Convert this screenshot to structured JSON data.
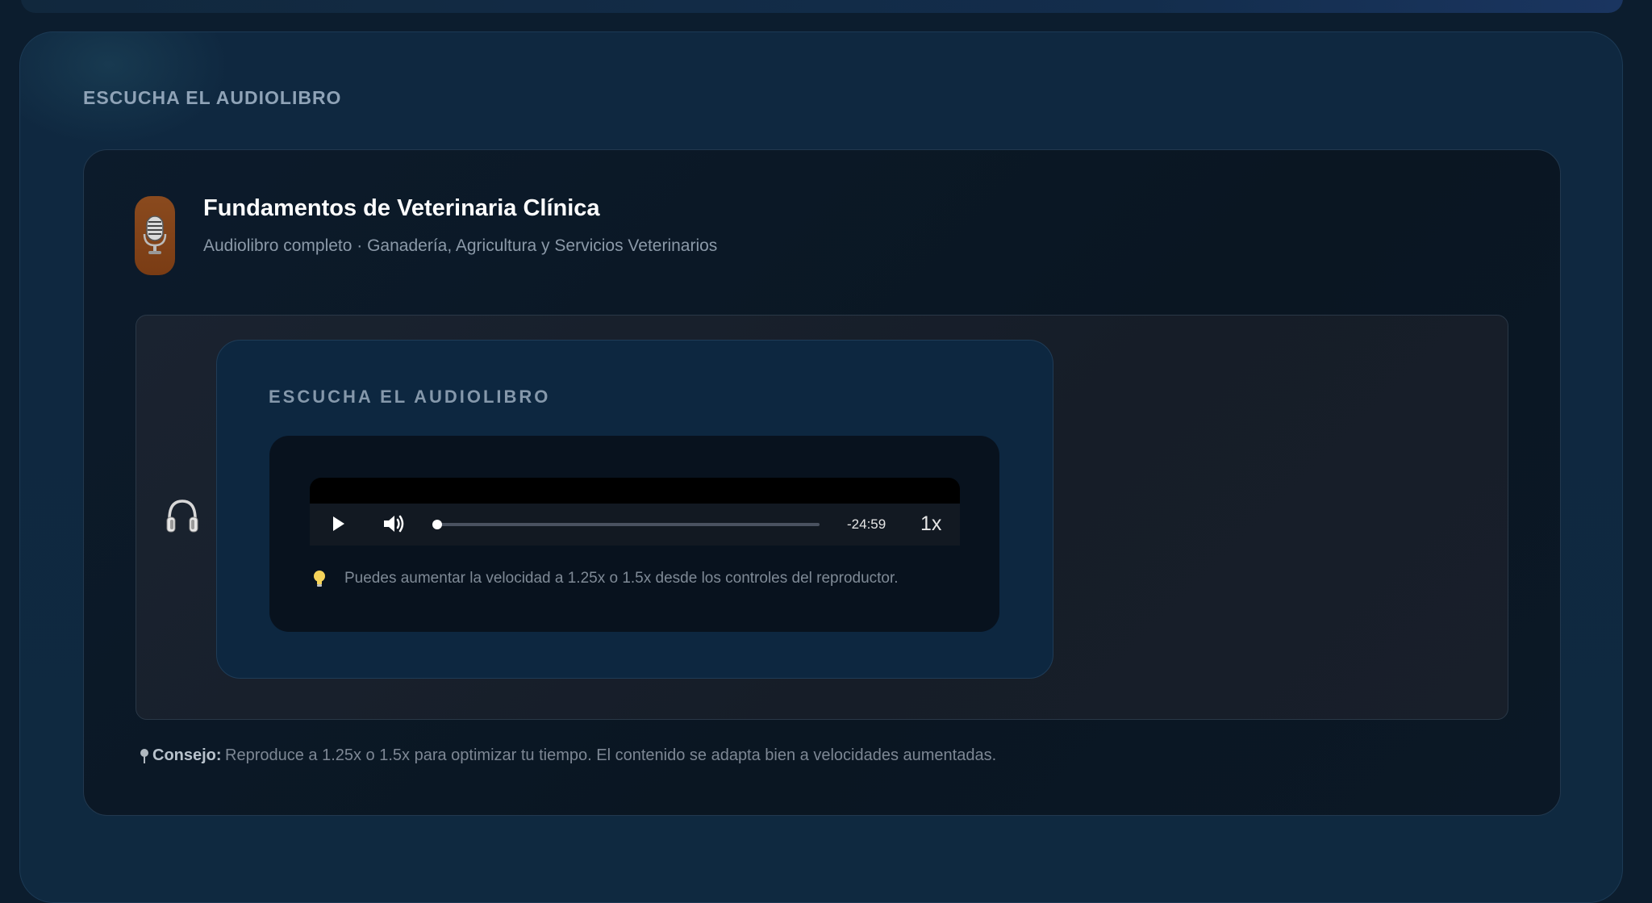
{
  "section": {
    "title": "ESCUCHA EL AUDIOLIBRO"
  },
  "book": {
    "title": "Fundamentos de Veterinaria Clínica",
    "subtitle": "Audiolibro completo · Ganadería, Agricultura y Servicios Veterinarios",
    "icon": "microphone-icon",
    "icon_bg": "#7f4219"
  },
  "player": {
    "title": "ESCUCHA EL AUDIOLIBRO",
    "icon": "headphones-icon",
    "time_remaining": "-24:59",
    "playback_rate": "1x",
    "progress": 0,
    "hint_icon": "lightbulb-icon",
    "hint": "Puedes aumentar la velocidad a 1.25x o 1.5x desde los controles del reproductor."
  },
  "tip": {
    "icon": "pin-icon",
    "label": "Consejo:",
    "text": "Reproduce a 1.25x o 1.5x para optimizar tu tiempo. El contenido se adapta bien a velocidades aumentadas."
  },
  "colors": {
    "background": "#0c1d2e",
    "card": "#0a1622",
    "player_card": "#0d2740",
    "accent_orange": "#7f4219"
  }
}
